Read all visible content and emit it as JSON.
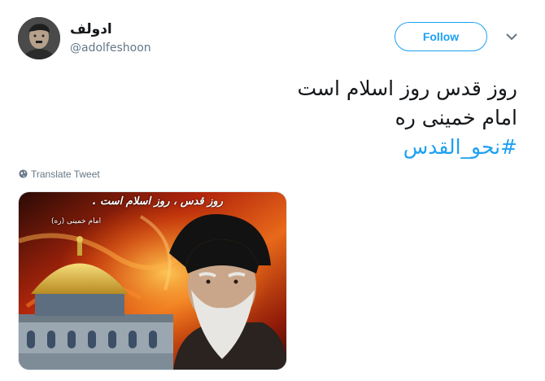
{
  "user": {
    "display_name": "ادولف",
    "handle": "@adolfeshoon",
    "avatar": "profile-photo"
  },
  "actions": {
    "follow_label": "Follow",
    "more_icon": "chevron-down-icon"
  },
  "tweet": {
    "lines": [
      "روز قدس روز اسلام است",
      "امام خمینی ره"
    ],
    "hashtag": "#نحو_القدس",
    "translate_label": "Translate Tweet",
    "translate_icon": "globe-icon"
  },
  "media": {
    "poster_title": "روز قدس ، روز اسلام است .",
    "poster_subtitle": "امام خمینی (ره)"
  },
  "colors": {
    "accent": "#1da1f2",
    "secondary_text": "#657786",
    "primary_text": "#14171a"
  }
}
